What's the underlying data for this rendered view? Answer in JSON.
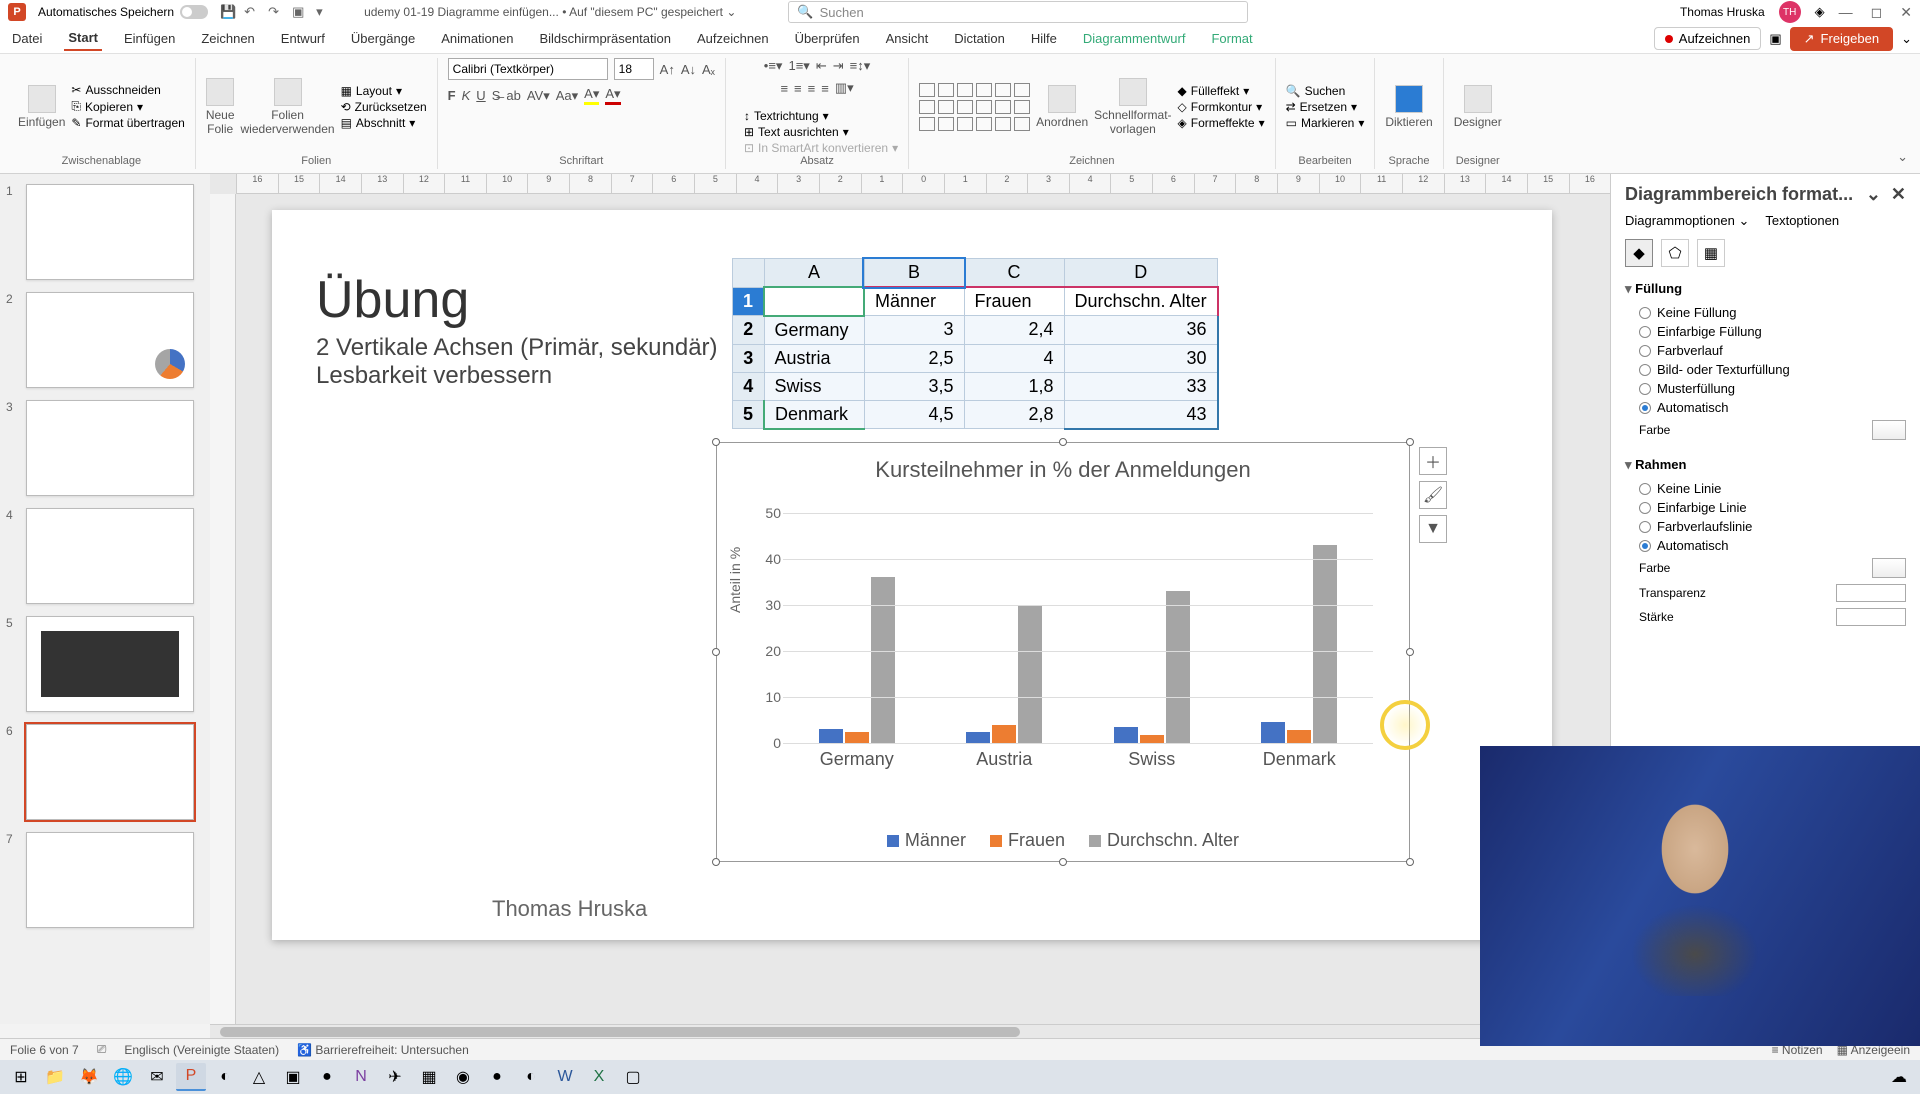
{
  "titlebar": {
    "autosave": "Automatisches Speichern",
    "doc": "udemy 01-19 Diagramme einfügen...",
    "saved": "Auf \"diesem PC\" gespeichert",
    "search_placeholder": "Suchen",
    "user_name": "Thomas Hruska",
    "user_initials": "TH"
  },
  "tabs": {
    "datei": "Datei",
    "start": "Start",
    "einfuegen": "Einfügen",
    "zeichnen": "Zeichnen",
    "entwurf": "Entwurf",
    "uebergaenge": "Übergänge",
    "animationen": "Animationen",
    "praes": "Bildschirmpräsentation",
    "aufzeichnen": "Aufzeichnen",
    "ueberpruefen": "Überprüfen",
    "ansicht": "Ansicht",
    "dictation": "Dictation",
    "hilfe": "Hilfe",
    "diagrammentwurf": "Diagrammentwurf",
    "format": "Format",
    "rec_btn": "Aufzeichnen",
    "share_btn": "Freigeben"
  },
  "ribbon": {
    "group_zwischenablage": "Zwischenablage",
    "einfuegen_btn": "Einfügen",
    "ausschneiden": "Ausschneiden",
    "kopieren": "Kopieren",
    "format_ueb": "Format übertragen",
    "group_folien": "Folien",
    "neue_folie": "Neue\nFolie",
    "folien_wieder": "Folien\nwiederverwenden",
    "layout": "Layout",
    "zuruecksetzen": "Zurücksetzen",
    "abschnitt": "Abschnitt",
    "group_schriftart": "Schriftart",
    "font_name": "Calibri (Textkörper)",
    "font_size": "18",
    "group_absatz": "Absatz",
    "textrichtung": "Textrichtung",
    "text_ausrichten": "Text ausrichten",
    "smartart": "In SmartArt konvertieren",
    "group_zeichnen": "Zeichnen",
    "anordnen": "Anordnen",
    "schnellformat": "Schnellformat-\nvorlagen",
    "fuelleffekt": "Fülleffekt",
    "formkontur": "Formkontur",
    "formeffekte": "Formeffekte",
    "group_bearbeiten": "Bearbeiten",
    "suchen": "Suchen",
    "ersetzen": "Ersetzen",
    "markieren": "Markieren",
    "group_sprache": "Sprache",
    "diktieren": "Diktieren",
    "group_designer": "Designer",
    "designer": "Designer"
  },
  "slide": {
    "title": "Übung",
    "sub1": "2 Vertikale Achsen (Primär, sekundär)",
    "sub2": "Lesbarkeit verbessern",
    "author": "Thomas Hruska"
  },
  "table": {
    "cols": [
      "A",
      "B",
      "C",
      "D"
    ],
    "headers": [
      "",
      "Männer",
      "Frauen",
      "Durchschn. Alter"
    ],
    "rows": [
      {
        "n": "2",
        "country": "Germany",
        "m": "3",
        "f": "2,4",
        "a": "36"
      },
      {
        "n": "3",
        "country": "Austria",
        "m": "2,5",
        "f": "4",
        "a": "30"
      },
      {
        "n": "4",
        "country": "Swiss",
        "m": "3,5",
        "f": "1,8",
        "a": "33"
      },
      {
        "n": "5",
        "country": "Denmark",
        "m": "4,5",
        "f": "2,8",
        "a": "43"
      }
    ]
  },
  "chart_data": {
    "type": "bar",
    "title": "Kursteilnehmer in % der Anmeldungen",
    "ylabel": "Anteil in %",
    "xlabel": "",
    "ylim": [
      0,
      50
    ],
    "yticks": [
      0,
      10,
      20,
      30,
      40,
      50
    ],
    "categories": [
      "Germany",
      "Austria",
      "Swiss",
      "Denmark"
    ],
    "series": [
      {
        "name": "Männer",
        "color": "#4472c4",
        "values": [
          3,
          2.5,
          3.5,
          4.5
        ]
      },
      {
        "name": "Frauen",
        "color": "#ed7d31",
        "values": [
          2.4,
          4,
          1.8,
          2.8
        ]
      },
      {
        "name": "Durchschn. Alter",
        "color": "#a5a5a5",
        "values": [
          36,
          30,
          33,
          43
        ]
      }
    ]
  },
  "format_pane": {
    "title": "Diagrammbereich format...",
    "tab1": "Diagrammoptionen",
    "tab2": "Textoptionen",
    "sec_fill": "Füllung",
    "fill_none": "Keine Füllung",
    "fill_solid": "Einfarbige Füllung",
    "fill_grad": "Farbverlauf",
    "fill_pic": "Bild- oder Texturfüllung",
    "fill_pat": "Musterfüllung",
    "fill_auto": "Automatisch",
    "color_label": "Farbe",
    "sec_border": "Rahmen",
    "border_none": "Keine Linie",
    "border_solid": "Einfarbige Linie",
    "border_grad": "Farbverlaufslinie",
    "border_auto": "Automatisch",
    "transparency": "Transparenz",
    "width": "Stärke"
  },
  "statusbar": {
    "slide_info": "Folie 6 von 7",
    "lang": "Englisch (Vereinigte Staaten)",
    "access": "Barrierefreiheit: Untersuchen",
    "notizen": "Notizen",
    "anzeige": "Anzeigeein"
  },
  "ruler_marks": [
    "16",
    "15",
    "14",
    "13",
    "12",
    "11",
    "10",
    "9",
    "8",
    "7",
    "6",
    "5",
    "4",
    "3",
    "2",
    "1",
    "0",
    "1",
    "2",
    "3",
    "4",
    "5",
    "6",
    "7",
    "8",
    "9",
    "10",
    "11",
    "12",
    "13",
    "14",
    "15",
    "16"
  ]
}
